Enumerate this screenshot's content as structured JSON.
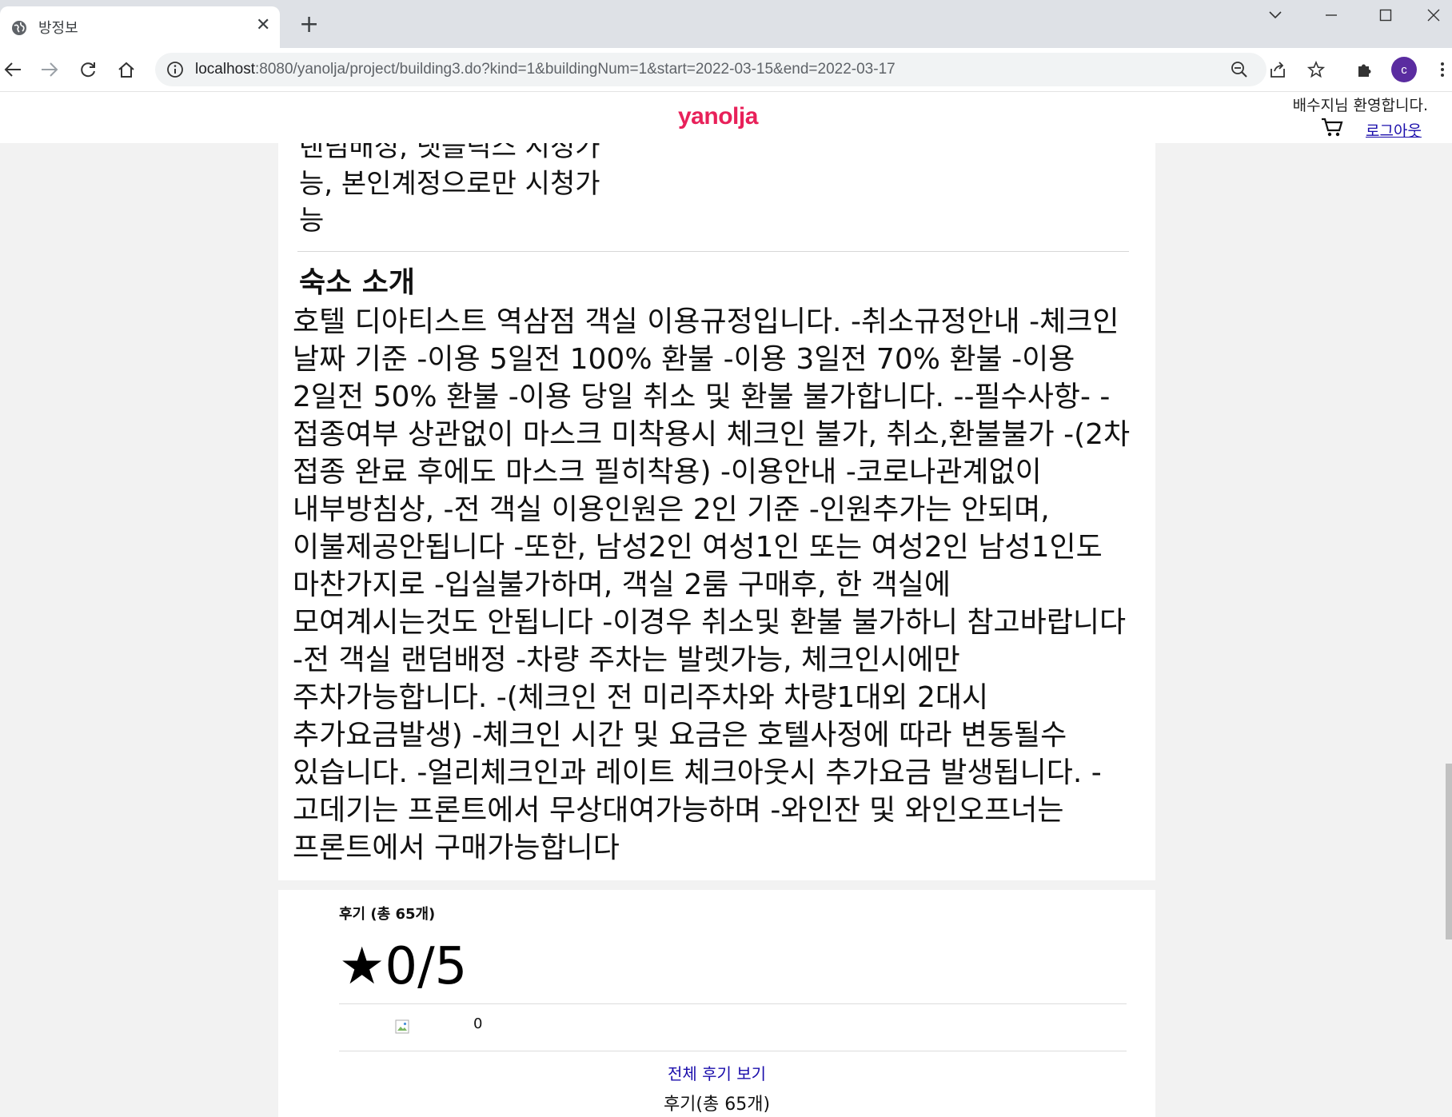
{
  "browser": {
    "tab_title": "방정보",
    "url_host": "localhost",
    "url_rest": ":8080/yanolja/project/building3.do?kind=1&buildingNum=1&start=2022-03-15&end=2022-03-17",
    "profile_initial": "c"
  },
  "header": {
    "logo": "yanolja",
    "welcome": "배수지님 환영합니다.",
    "logout": "로그아웃"
  },
  "content": {
    "amenity_text": "랜덤배성, 넷플릭스 시정가능, 본인계정으로만 시청가능",
    "section_title": "숙소 소개",
    "intro_text": "호텔 디아티스트 역삼점 객실 이용규정입니다. -취소규정안내 -체크인 날짜 기준 -이용 5일전 100% 환불 -이용 3일전 70% 환불 -이용 2일전 50% 환불 -이용 당일 취소 및 환불 불가합니다. --필수사항- -접종여부 상관없이 마스크 미착용시 체크인 불가, 취소,환불불가 -(2차 접종 완료 후에도 마스크 필히착용) -이용안내 -코로나관계없이 내부방침상, -전 객실 이용인원은 2인 기준 -인원추가는 안되며, 이불제공안됩니다 -또한, 남성2인 여성1인 또는 여성2인 남성1인도 마찬가지로 -입실불가하며, 객실 2룸 구매후, 한 객실에 모여계시는것도 안됩니다 -이경우 취소및 환불 불가하니 참고바랍니다 -전 객실 랜덤배정 -차량 주차는 발렛가능, 체크인시에만 주차가능합니다. -(체크인 전 미리주차와 차량1대외 2대시 추가요금발생) -체크인 시간 및 요금은 호텔사정에 따라 변동될수 있습니다. -얼리체크인과 레이트 체크아웃시 추가요금 발생됩니다. -고데기는 프론트에서 무상대여가능하며 -와인잔 및 와인오프너는 프론트에서 구매가능합니다"
  },
  "reviews": {
    "title": "후기 (총 65개)",
    "rating": "★0/5",
    "count": "0",
    "all_link": "전체 후기 보기",
    "summary": "후기(총 65개)"
  }
}
